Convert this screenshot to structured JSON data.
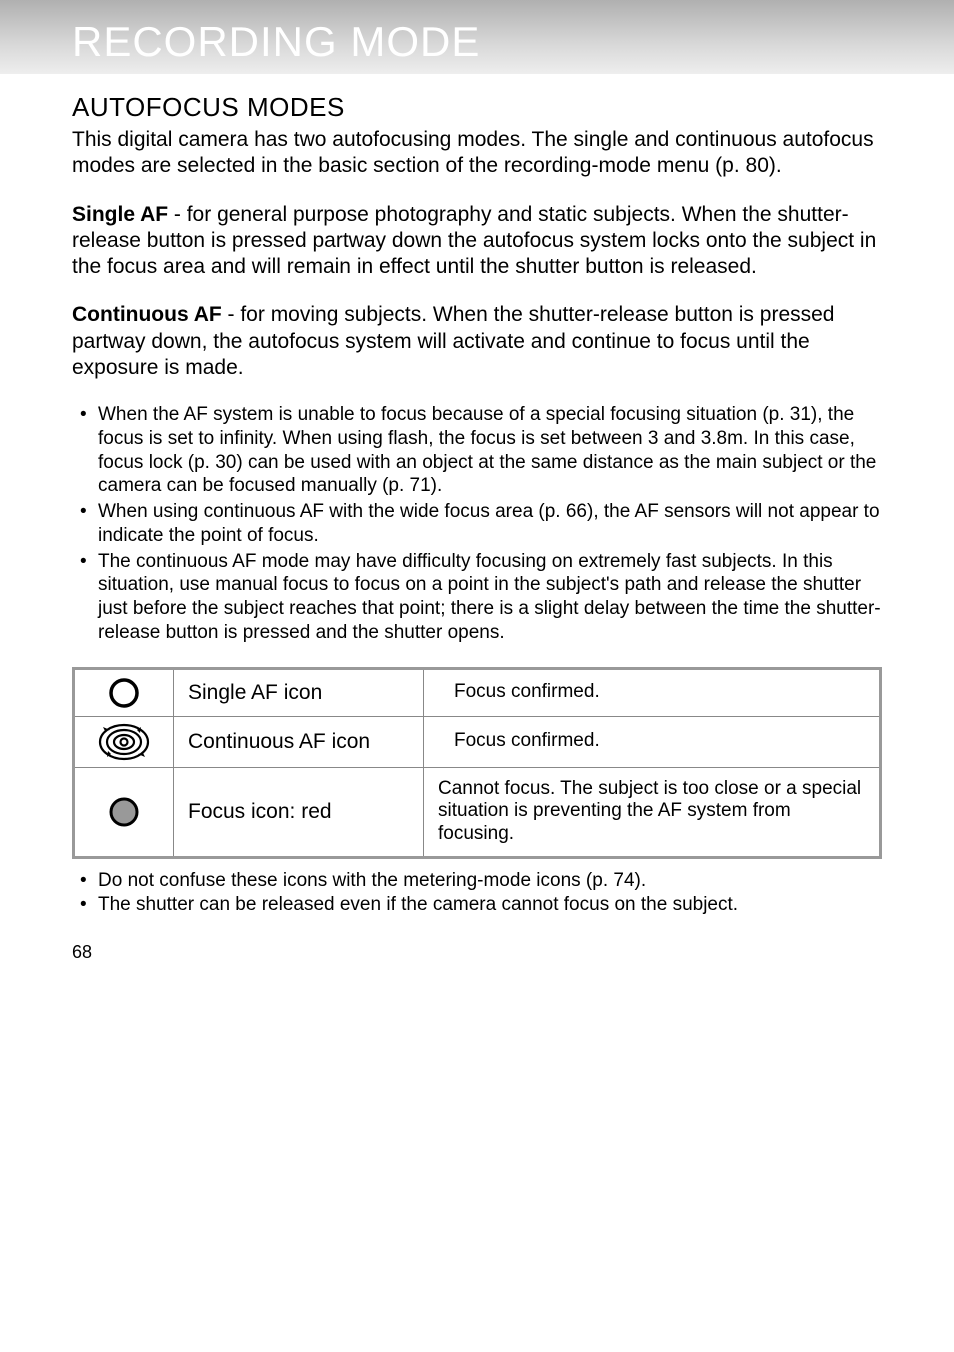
{
  "header": "RECORDING MODE",
  "section_title": "AUTOFOCUS MODES",
  "intro": "This digital camera has two autofocusing modes. The single and continuous autofocus modes are selected in the basic section of the recording-mode menu (p. 80).",
  "single_label": "Single AF",
  "single_text": " - for general purpose photography and static subjects. When the shutter-release button is pressed partway down the autofocus system locks onto the subject in the focus area and will remain in effect until the shutter button is released.",
  "continuous_label": "Continuous AF",
  "continuous_text": " - for moving subjects. When the shutter-release button is pressed partway down, the autofocus system will activate and continue to focus until the exposure is made.",
  "bullets": {
    "b1": "When the AF system is unable to focus because of a special focusing situation (p. 31), the focus is set to infinity. When using flash, the focus is set between 3 and 3.8m. In this case, focus lock (p. 30) can be used with an object at the same distance as the main subject or the camera can be focused manually (p. 71).",
    "b2": "When using continuous AF with the wide focus area (p. 66), the AF sensors will not appear to indicate the point of focus.",
    "b3": "The continuous AF mode may have difficulty focusing on extremely fast subjects. In this situation, use manual focus to focus on a point in the subject's path and release the shutter just before the subject reaches that point; there is a slight delay between the time the shutter-release button is pressed and the shutter opens."
  },
  "table": {
    "r1_label": "Single AF icon",
    "r1_desc": "Focus confirmed.",
    "r2_label": "Continuous AF icon",
    "r2_desc": "Focus confirmed.",
    "r3_label": "Focus icon: red",
    "r3_desc": "Cannot focus. The subject is too close or a special situation is preventing the AF system from focusing."
  },
  "notes": {
    "n1": "Do not confuse these icons with the metering-mode icons (p. 74).",
    "n2": "The shutter can be released even if the camera cannot focus on the subject."
  },
  "page_number": "68"
}
